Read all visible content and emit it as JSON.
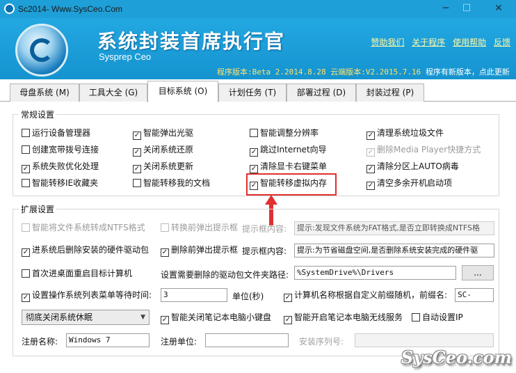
{
  "window": {
    "title": "Sc2014- Www.SysCeo.Com",
    "minimize": "─",
    "maximize": "☐",
    "close": "✕"
  },
  "banner": {
    "title": "系统封装首席执行官",
    "subtitle": "Sysprep  Ceo",
    "links": [
      "赞助我们",
      "关于程序",
      "使用帮助",
      "反馈"
    ],
    "version_text": "程序版本:Beta 2.2014.8.28 云端版本:V2.2015.7.16",
    "update_text": "程序有新版本，点此更新"
  },
  "tabs": [
    {
      "label": "母盘系统 (M)",
      "active": false
    },
    {
      "label": "工具大全 (G)",
      "active": false
    },
    {
      "label": "目标系统 (O)",
      "active": true
    },
    {
      "label": "计划任务 (T)",
      "active": false
    },
    {
      "label": "部署过程 (D)",
      "active": false
    },
    {
      "label": "封装过程 (P)",
      "active": false
    }
  ],
  "general": {
    "title": "常规设置",
    "items": [
      {
        "label": "运行设备管理器",
        "checked": false,
        "disabled": false
      },
      {
        "label": "智能弹出光驱",
        "checked": true,
        "disabled": false
      },
      {
        "label": "智能调整分辨率",
        "checked": false,
        "disabled": false
      },
      {
        "label": "清理系统垃圾文件",
        "checked": true,
        "disabled": false
      },
      {
        "label": "创建宽带拨号连接",
        "checked": false,
        "disabled": false
      },
      {
        "label": "关闭系统还原",
        "checked": true,
        "disabled": false
      },
      {
        "label": "跳过Internet向导",
        "checked": true,
        "disabled": false
      },
      {
        "label": "删除Media Player快捷方式",
        "checked": true,
        "disabled": true
      },
      {
        "label": "系统失败优化处理",
        "checked": true,
        "disabled": false
      },
      {
        "label": "关闭系统更新",
        "checked": true,
        "disabled": false
      },
      {
        "label": "清除显卡右键菜单",
        "checked": true,
        "disabled": false
      },
      {
        "label": "清除分区上AUTO病毒",
        "checked": true,
        "disabled": false
      },
      {
        "label": "智能转移IE收藏夹",
        "checked": false,
        "disabled": false
      },
      {
        "label": "智能转移我的文档",
        "checked": false,
        "disabled": false
      },
      {
        "label": "智能转移虚拟内存",
        "checked": true,
        "disabled": false
      },
      {
        "label": "清空多余开机启动项",
        "checked": true,
        "disabled": false
      }
    ]
  },
  "extended": {
    "title": "扩展设置",
    "ntfs_convert": {
      "label": "智能将文件系统转成NTFS格式",
      "checked": false
    },
    "ntfs_popup": {
      "label": "转换前弹出提示框",
      "checked": false
    },
    "ntfs_prompt_label": "提示框内容:",
    "ntfs_prompt_value": "提示:发现文件系统为FAT格式,是否立即转换成NTFS格",
    "del_driver": {
      "label": "进系统后删除安装的硬件驱动包",
      "checked": true
    },
    "del_popup": {
      "label": "删除前弹出提示框",
      "checked": true
    },
    "del_prompt_label": "提示框内容:",
    "del_prompt_value": "提示:为节省磁盘空间,是否删除系统安装完成的硬件驱",
    "restart": {
      "label": "首次进桌面重启目标计算机",
      "checked": false
    },
    "driver_path_label": "设置需要删除的驱动包文件夹路径:",
    "driver_path_value": "%SystemDrive%\\Drivers",
    "browse_label": "...",
    "wait": {
      "label": "设置操作系统列表菜单等待时间:",
      "checked": true
    },
    "wait_value": "3",
    "wait_unit": "单位(秒)",
    "computer_name": {
      "label": "计算机名称根据自定义前缀随机，前缀名:",
      "checked": true
    },
    "prefix_value": "SC-",
    "sleep_option": "彻底关闭系统休眠",
    "close_keyboard": {
      "label": "智能关闭笔记本电脑小键盘",
      "checked": true
    },
    "open_wireless": {
      "label": "智能开启笔记本电脑无线服务",
      "checked": true
    },
    "auto_ip": {
      "label": "自动设置IP",
      "checked": false
    },
    "reg_name_label": "注册名称:",
    "reg_name_value": "Windows 7",
    "reg_org_label": "注册单位:",
    "reg_org_value": "",
    "serial_label": "安装序列号:",
    "serial_value": ""
  },
  "watermark": "SysCeo.com",
  "colors": {
    "title_bar": "#1e9fd8",
    "highlight": "#e03030",
    "link": "#fff8a8"
  }
}
